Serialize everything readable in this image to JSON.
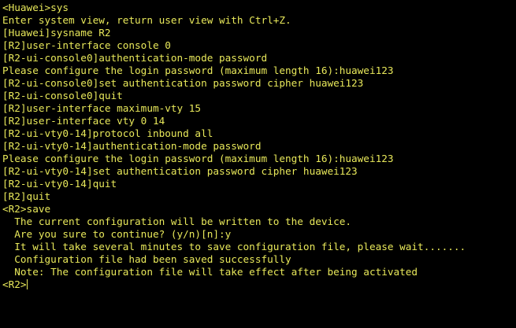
{
  "terminal": {
    "text_color": "#e8e85a",
    "background_color": "#000000",
    "lines": [
      "<Huawei>sys",
      "Enter system view, return user view with Ctrl+Z.",
      "[Huawei]sysname R2",
      "[R2]user-interface console 0",
      "[R2-ui-console0]authentication-mode password",
      "Please configure the login password (maximum length 16):huawei123",
      "[R2-ui-console0]set authentication password cipher huawei123",
      "[R2-ui-console0]quit",
      "[R2]user-interface maximum-vty 15",
      "[R2]user-interface vty 0 14",
      "[R2-ui-vty0-14]protocol inbound all",
      "[R2-ui-vty0-14]authentication-mode password",
      "Please configure the login password (maximum length 16):huawei123",
      "[R2-ui-vty0-14]set authentication password cipher huawei123",
      "[R2-ui-vty0-14]quit",
      "[R2]quit",
      "<R2>save",
      "  The current configuration will be written to the device.",
      "  Are you sure to continue? (y/n)[n]:y",
      "  It will take several minutes to save configuration file, please wait.......",
      "  Configuration file had been saved successfully",
      "  Note: The configuration file will take effect after being activated"
    ],
    "prompt": "<R2>"
  }
}
